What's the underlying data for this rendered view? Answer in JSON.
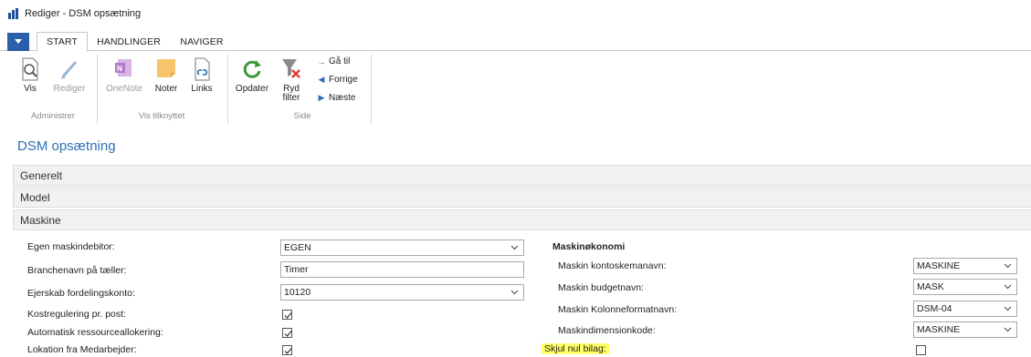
{
  "window": {
    "title": "Rediger - DSM opsætning"
  },
  "ribbon": {
    "tabs": [
      "START",
      "HANDLINGER",
      "NAVIGER"
    ],
    "buttons": {
      "vis": "Vis",
      "rediger": "Rediger",
      "onenote": "OneNote",
      "noter": "Noter",
      "links": "Links",
      "opdater": "Opdater",
      "ryd_filter_1": "Ryd",
      "ryd_filter_2": "filter",
      "gaa_til": "Gå til",
      "forrige": "Forrige",
      "naeste": "Næste"
    },
    "groups": {
      "administrer": "Administrer",
      "vis_tilknyttet": "Vis tilknyttet",
      "side": "Side"
    }
  },
  "page": {
    "title": "DSM opsætning",
    "fasttabs": [
      "Generelt",
      "Model",
      "Maskine"
    ]
  },
  "maskine": {
    "left": {
      "egen_maskindebitor": {
        "label": "Egen maskindebitor:",
        "value": "EGEN"
      },
      "branchenavn": {
        "label": "Branchenavn på tæller:",
        "value": "Timer"
      },
      "ejerskab": {
        "label": "Ejerskab fordelingskonto:",
        "value": "10120"
      },
      "kostregulering": {
        "label": "Kostregulering pr. post:",
        "checked": true
      },
      "auto_ressource": {
        "label": "Automatisk ressourceallokering:",
        "checked": true
      },
      "lokation": {
        "label": "Lokation fra Medarbejder:",
        "checked": true
      }
    },
    "right": {
      "section_title": "Maskinøkonomi",
      "kontoskemanavn": {
        "label": "Maskin kontoskemanavn:",
        "value": "MASKINE"
      },
      "budgetnavn": {
        "label": "Maskin budgetnavn:",
        "value": "MASK"
      },
      "kolonneformatnavn": {
        "label": "Maskin Kolonneformatnavn:",
        "value": "DSM-04"
      },
      "dimensionkode": {
        "label": "Maskindimensionkode:",
        "value": "MASKINE"
      },
      "skjul_nul_bilag": {
        "label": "Skjul nul bilag:",
        "checked": false
      }
    }
  }
}
